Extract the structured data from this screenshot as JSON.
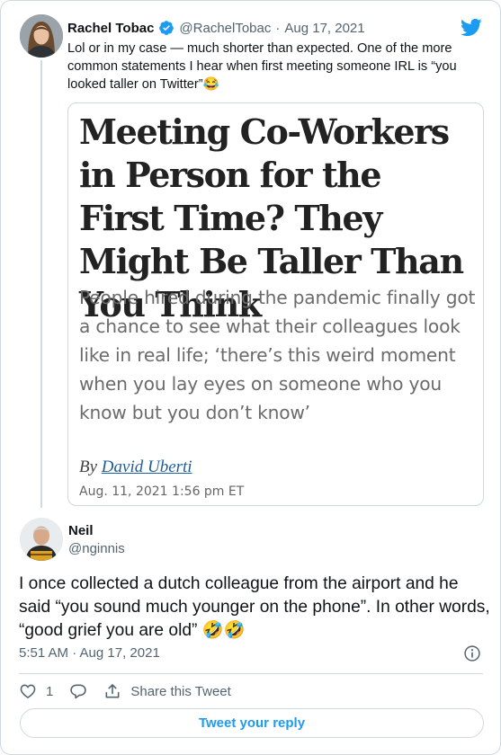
{
  "quoted_tweet": {
    "author_name": "Rachel Tobac",
    "handle": "@RachelTobac",
    "separator": "·",
    "date": "Aug 17, 2021",
    "text": "Lol or in my case — much shorter than expected. One of the more common statements I hear when first meeting someone IRL is “you looked taller on Twitter”😂",
    "article": {
      "headline": "Meeting Co-Workers in Person for the First Time? They Might Be Taller Than You Think",
      "dek": "People hired during the pandemic finally got a chance to see what their colleagues look like in real life; ‘there’s this weird moment when you lay eyes on someone who you know but you don’t know’",
      "byline_prefix": "By",
      "author": "David Uberti",
      "date": "Aug. 11, 2021 1:56 pm ET"
    }
  },
  "reply_tweet": {
    "author_name": "Neil",
    "handle": "@nginnis",
    "text": "I once collected a dutch colleague from the airport and he said “you sound much younger on the phone”. In other words, “good grief you are old” 🤣🤣",
    "time": "5:51 AM · Aug 17, 2021"
  },
  "actions": {
    "like_count": "1",
    "share_label": "Share this Tweet"
  },
  "reply_button_label": "Tweet your reply",
  "colors": {
    "accent": "#1d9bf0",
    "muted": "#536471",
    "border": "#cfd9de"
  },
  "icons": [
    "verified-badge-icon",
    "twitter-bird-icon",
    "info-icon",
    "heart-icon",
    "reply-bubble-icon",
    "share-icon"
  ]
}
